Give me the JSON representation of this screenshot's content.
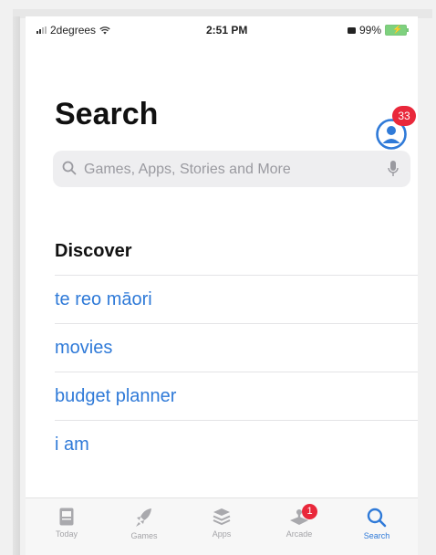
{
  "status_bar": {
    "carrier": "2degrees",
    "time": "2:51 PM",
    "battery": "99%"
  },
  "header": {
    "title": "Search",
    "account_badge_count": "33"
  },
  "search": {
    "placeholder": "Games, Apps, Stories and More"
  },
  "discover": {
    "title": "Discover",
    "items": [
      {
        "label": "te reo māori"
      },
      {
        "label": "movies"
      },
      {
        "label": "budget planner"
      },
      {
        "label": "i am"
      }
    ]
  },
  "tab_bar": {
    "tabs": [
      {
        "label": "Today",
        "icon": "today-icon"
      },
      {
        "label": "Games",
        "icon": "rocket-icon"
      },
      {
        "label": "Apps",
        "icon": "stack-icon"
      },
      {
        "label": "Arcade",
        "icon": "joystick-icon",
        "badge": "1"
      },
      {
        "label": "Search",
        "icon": "search-icon",
        "active": true
      }
    ]
  },
  "colors": {
    "accent": "#2f7ad8",
    "badge": "#e9283b"
  }
}
